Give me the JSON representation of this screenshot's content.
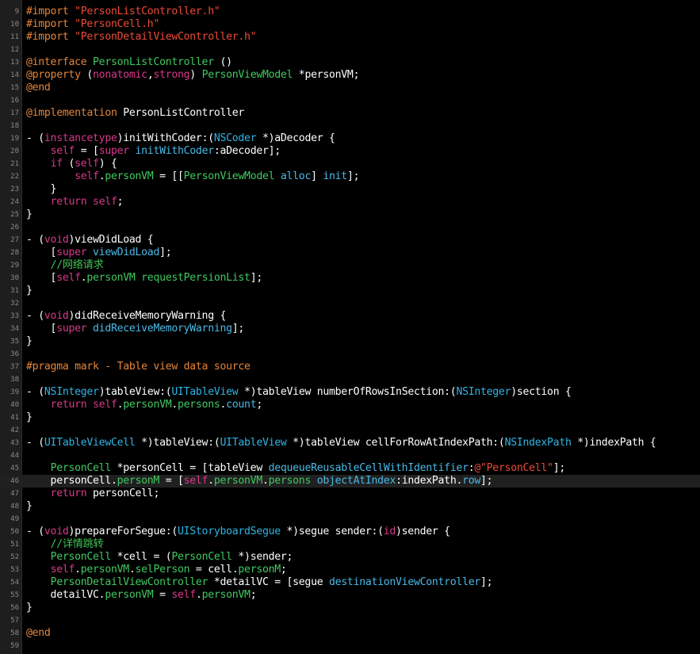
{
  "editor": {
    "colors": {
      "background": "#000000",
      "plain": "#ffffff",
      "keyword": "#d7388b",
      "preprocessor": "#e5853a",
      "string": "#ed4a37",
      "system_class": "#2fb4e4",
      "project_symbol": "#41c960",
      "method": "#4ab9e6",
      "comment": "#3fc353"
    },
    "current_line": 46,
    "lines": [
      {
        "n": "9",
        "segs": [
          [
            "pre",
            "#import "
          ],
          [
            "str",
            "\"PersonListController.h\""
          ]
        ]
      },
      {
        "n": "10",
        "segs": [
          [
            "pre",
            "#import "
          ],
          [
            "str",
            "\"PersonCell.h\""
          ]
        ]
      },
      {
        "n": "11",
        "segs": [
          [
            "pre",
            "#import "
          ],
          [
            "str",
            "\"PersonDetailViewController.h\""
          ]
        ]
      },
      {
        "n": "12",
        "segs": []
      },
      {
        "n": "13",
        "segs": [
          [
            "pre",
            "@interface "
          ],
          [
            "proj",
            "PersonListController"
          ],
          [
            "plain",
            " ()"
          ]
        ]
      },
      {
        "n": "14",
        "segs": [
          [
            "pre",
            "@property "
          ],
          [
            "plain",
            "("
          ],
          [
            "kw",
            "nonatomic"
          ],
          [
            "plain",
            ","
          ],
          [
            "kw",
            "strong"
          ],
          [
            "plain",
            ") "
          ],
          [
            "proj",
            "PersonViewModel"
          ],
          [
            "plain",
            " *personVM;"
          ]
        ]
      },
      {
        "n": "15",
        "segs": [
          [
            "pre",
            "@end"
          ]
        ]
      },
      {
        "n": "16",
        "segs": []
      },
      {
        "n": "17",
        "segs": [
          [
            "pre",
            "@implementation "
          ],
          [
            "plain",
            "PersonListController"
          ]
        ]
      },
      {
        "n": "18",
        "segs": []
      },
      {
        "n": "19",
        "segs": [
          [
            "plain",
            "- ("
          ],
          [
            "kw",
            "instancetype"
          ],
          [
            "plain",
            ")initWithCoder:("
          ],
          [
            "cls",
            "NSCoder"
          ],
          [
            "plain",
            " *)aDecoder {"
          ]
        ]
      },
      {
        "n": "20",
        "segs": [
          [
            "plain",
            "    "
          ],
          [
            "kw",
            "self"
          ],
          [
            "plain",
            " = ["
          ],
          [
            "kw",
            "super"
          ],
          [
            "plain",
            " "
          ],
          [
            "meth",
            "initWithCoder"
          ],
          [
            "plain",
            ":aDecoder];"
          ]
        ]
      },
      {
        "n": "21",
        "segs": [
          [
            "plain",
            "    "
          ],
          [
            "kw",
            "if"
          ],
          [
            "plain",
            " ("
          ],
          [
            "kw",
            "self"
          ],
          [
            "plain",
            ") {"
          ]
        ]
      },
      {
        "n": "22",
        "segs": [
          [
            "plain",
            "        "
          ],
          [
            "kw",
            "self"
          ],
          [
            "plain",
            "."
          ],
          [
            "proj",
            "personVM"
          ],
          [
            "plain",
            " = [["
          ],
          [
            "proj",
            "PersonViewModel"
          ],
          [
            "plain",
            " "
          ],
          [
            "meth",
            "alloc"
          ],
          [
            "plain",
            "] "
          ],
          [
            "meth",
            "init"
          ],
          [
            "plain",
            "];"
          ]
        ]
      },
      {
        "n": "23",
        "segs": [
          [
            "plain",
            "    }"
          ]
        ]
      },
      {
        "n": "24",
        "segs": [
          [
            "plain",
            "    "
          ],
          [
            "kw",
            "return"
          ],
          [
            "plain",
            " "
          ],
          [
            "kw",
            "self"
          ],
          [
            "plain",
            ";"
          ]
        ]
      },
      {
        "n": "25",
        "segs": [
          [
            "plain",
            "}"
          ]
        ]
      },
      {
        "n": "26",
        "segs": []
      },
      {
        "n": "27",
        "segs": [
          [
            "plain",
            "- ("
          ],
          [
            "kw",
            "void"
          ],
          [
            "plain",
            ")viewDidLoad {"
          ]
        ]
      },
      {
        "n": "28",
        "segs": [
          [
            "plain",
            "    ["
          ],
          [
            "kw",
            "super"
          ],
          [
            "plain",
            " "
          ],
          [
            "meth",
            "viewDidLoad"
          ],
          [
            "plain",
            "];"
          ]
        ]
      },
      {
        "n": "29",
        "segs": [
          [
            "plain",
            "    "
          ],
          [
            "comm",
            "//网络请求"
          ]
        ]
      },
      {
        "n": "30",
        "segs": [
          [
            "plain",
            "    ["
          ],
          [
            "kw",
            "self"
          ],
          [
            "plain",
            "."
          ],
          [
            "proj",
            "personVM"
          ],
          [
            "plain",
            " "
          ],
          [
            "proj",
            "requestPersionList"
          ],
          [
            "plain",
            "];"
          ]
        ]
      },
      {
        "n": "31",
        "segs": [
          [
            "plain",
            "}"
          ]
        ]
      },
      {
        "n": "32",
        "segs": []
      },
      {
        "n": "33",
        "segs": [
          [
            "plain",
            "- ("
          ],
          [
            "kw",
            "void"
          ],
          [
            "plain",
            ")didReceiveMemoryWarning {"
          ]
        ]
      },
      {
        "n": "34",
        "segs": [
          [
            "plain",
            "    ["
          ],
          [
            "kw",
            "super"
          ],
          [
            "plain",
            " "
          ],
          [
            "meth",
            "didReceiveMemoryWarning"
          ],
          [
            "plain",
            "];"
          ]
        ]
      },
      {
        "n": "35",
        "segs": [
          [
            "plain",
            "}"
          ]
        ]
      },
      {
        "n": "36",
        "segs": []
      },
      {
        "n": "37",
        "segs": [
          [
            "pre",
            "#pragma mark - Table view data source"
          ]
        ]
      },
      {
        "n": "38",
        "segs": []
      },
      {
        "n": "39",
        "segs": [
          [
            "plain",
            "- ("
          ],
          [
            "cls",
            "NSInteger"
          ],
          [
            "plain",
            ")tableView:("
          ],
          [
            "cls",
            "UITableView"
          ],
          [
            "plain",
            " *)tableView numberOfRowsInSection:("
          ],
          [
            "cls",
            "NSInteger"
          ],
          [
            "plain",
            ")section {"
          ]
        ]
      },
      {
        "n": "40",
        "segs": [
          [
            "plain",
            "    "
          ],
          [
            "kw",
            "return"
          ],
          [
            "plain",
            " "
          ],
          [
            "kw",
            "self"
          ],
          [
            "plain",
            "."
          ],
          [
            "proj",
            "personVM"
          ],
          [
            "plain",
            "."
          ],
          [
            "proj",
            "persons"
          ],
          [
            "plain",
            "."
          ],
          [
            "meth",
            "count"
          ],
          [
            "plain",
            ";"
          ]
        ]
      },
      {
        "n": "41",
        "segs": [
          [
            "plain",
            "}"
          ]
        ]
      },
      {
        "n": "42",
        "segs": []
      },
      {
        "n": "43",
        "segs": [
          [
            "plain",
            "- ("
          ],
          [
            "cls",
            "UITableViewCell"
          ],
          [
            "plain",
            " *)tableView:("
          ],
          [
            "cls",
            "UITableView"
          ],
          [
            "plain",
            " *)tableView cellForRowAtIndexPath:("
          ],
          [
            "cls",
            "NSIndexPath"
          ],
          [
            "plain",
            " *)indexPath {"
          ]
        ]
      },
      {
        "n": "44",
        "segs": []
      },
      {
        "n": "45",
        "segs": [
          [
            "plain",
            "    "
          ],
          [
            "proj",
            "PersonCell"
          ],
          [
            "plain",
            " *personCell = [tableView "
          ],
          [
            "meth",
            "dequeueReusableCellWithIdentifier"
          ],
          [
            "plain",
            ":"
          ],
          [
            "str",
            "@\"PersonCell\""
          ],
          [
            "plain",
            "];"
          ]
        ]
      },
      {
        "n": "46",
        "segs": [
          [
            "plain",
            "    personCell."
          ],
          [
            "proj",
            "personM"
          ],
          [
            "plain",
            " = ["
          ],
          [
            "kw",
            "self"
          ],
          [
            "plain",
            "."
          ],
          [
            "proj",
            "personVM"
          ],
          [
            "plain",
            "."
          ],
          [
            "proj",
            "persons"
          ],
          [
            "plain",
            " "
          ],
          [
            "meth",
            "objectAtIndex"
          ],
          [
            "plain",
            ":indexPath."
          ],
          [
            "meth",
            "row"
          ],
          [
            "plain",
            "];"
          ]
        ]
      },
      {
        "n": "47",
        "segs": [
          [
            "plain",
            "    "
          ],
          [
            "kw",
            "return"
          ],
          [
            "plain",
            " personCell;"
          ]
        ]
      },
      {
        "n": "48",
        "segs": [
          [
            "plain",
            "}"
          ]
        ]
      },
      {
        "n": "49",
        "segs": []
      },
      {
        "n": "50",
        "segs": [
          [
            "plain",
            "- ("
          ],
          [
            "kw",
            "void"
          ],
          [
            "plain",
            ")prepareForSegue:("
          ],
          [
            "cls",
            "UIStoryboardSegue"
          ],
          [
            "plain",
            " *)segue sender:("
          ],
          [
            "kw",
            "id"
          ],
          [
            "plain",
            ")sender {"
          ]
        ]
      },
      {
        "n": "51",
        "segs": [
          [
            "plain",
            "    "
          ],
          [
            "comm",
            "//详情跳转"
          ]
        ]
      },
      {
        "n": "52",
        "segs": [
          [
            "plain",
            "    "
          ],
          [
            "proj",
            "PersonCell"
          ],
          [
            "plain",
            " *cell = ("
          ],
          [
            "proj",
            "PersonCell"
          ],
          [
            "plain",
            " *)sender;"
          ]
        ]
      },
      {
        "n": "53",
        "segs": [
          [
            "plain",
            "    "
          ],
          [
            "kw",
            "self"
          ],
          [
            "plain",
            "."
          ],
          [
            "proj",
            "personVM"
          ],
          [
            "plain",
            "."
          ],
          [
            "proj",
            "selPerson"
          ],
          [
            "plain",
            " = cell."
          ],
          [
            "proj",
            "personM"
          ],
          [
            "plain",
            ";"
          ]
        ]
      },
      {
        "n": "54",
        "segs": [
          [
            "plain",
            "    "
          ],
          [
            "proj",
            "PersonDetailViewController"
          ],
          [
            "plain",
            " *detailVC = [segue "
          ],
          [
            "meth",
            "destinationViewController"
          ],
          [
            "plain",
            "];"
          ]
        ]
      },
      {
        "n": "55",
        "segs": [
          [
            "plain",
            "    detailVC."
          ],
          [
            "proj",
            "personVM"
          ],
          [
            "plain",
            " = "
          ],
          [
            "kw",
            "self"
          ],
          [
            "plain",
            "."
          ],
          [
            "proj",
            "personVM"
          ],
          [
            "plain",
            ";"
          ]
        ]
      },
      {
        "n": "56",
        "segs": [
          [
            "plain",
            "}"
          ]
        ]
      },
      {
        "n": "57",
        "segs": []
      },
      {
        "n": "58",
        "segs": [
          [
            "pre",
            "@end"
          ]
        ]
      },
      {
        "n": "59",
        "segs": []
      }
    ]
  }
}
